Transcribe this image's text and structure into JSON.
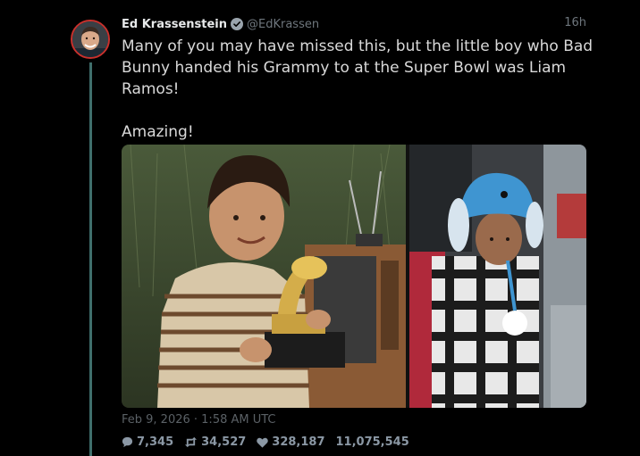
{
  "tweet": {
    "author_name": "Ed Krassenstein",
    "handle": "@EdKrassen",
    "time_ago": "16h",
    "text": "Many of you may have missed this, but the little boy who Bad Bunny handed his Grammy to at the Super Bowl was Liam Ramos!\n\nAmazing!",
    "date": "Feb 9, 2026 · 1:58 AM UTC",
    "stats": {
      "replies": "7,345",
      "retweets": "34,527",
      "likes": "328,187",
      "views": "11,075,545"
    }
  },
  "icons": {
    "verified": "verified-badge-icon",
    "reply": "speech-bubble-icon",
    "retweet": "retweet-arrows-icon",
    "like": "heart-icon"
  },
  "colors": {
    "background": "#000000",
    "thread_line": "#3f6f6c",
    "avatar_ring": "#c9302c",
    "name": "#e7e9ea",
    "muted": "#6e767d"
  }
}
